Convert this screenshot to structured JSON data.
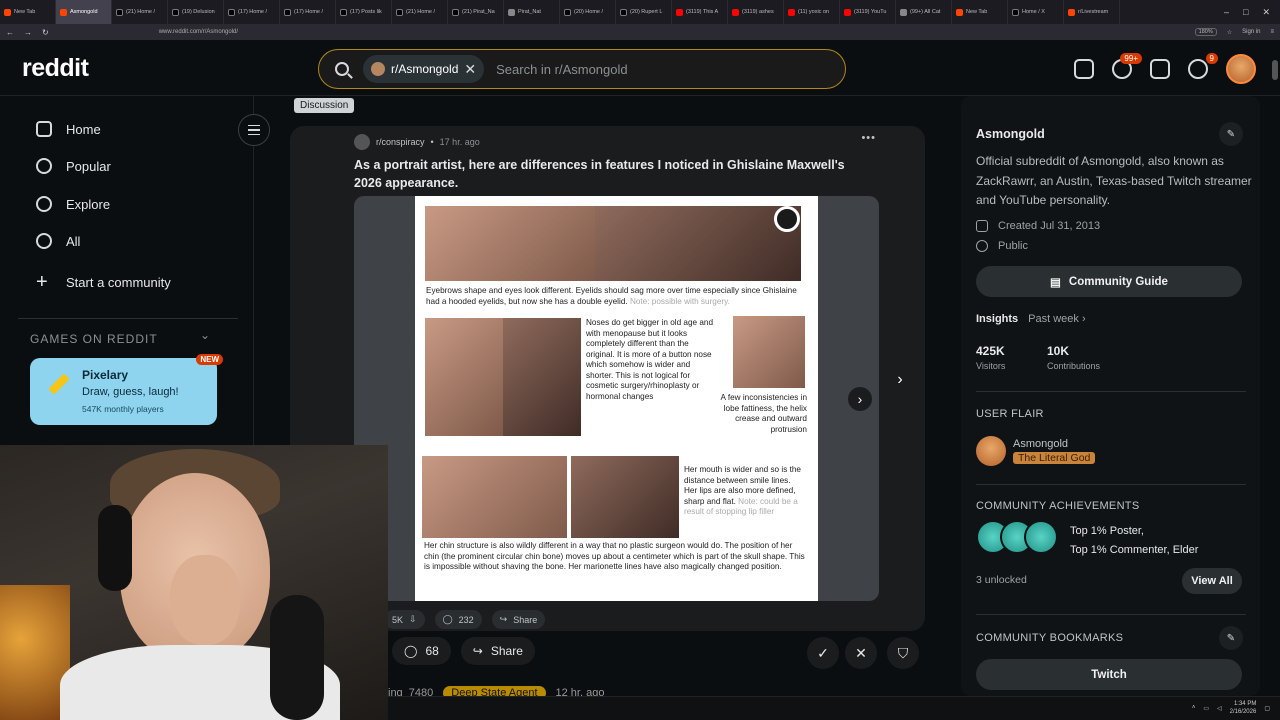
{
  "browser": {
    "tabs": [
      "New Tab",
      "Asmongold",
      "(21) Home /",
      "(19) Delusion",
      "(17) Home /",
      "(17) Home /",
      "(17) Posts lik",
      "(21) Home /",
      "(21) Pirat_Na",
      "Pirat_Nat",
      "(20) Home /",
      "(20) Rupert L",
      "(3119) This A",
      "(3119) ashes",
      "(11) yoxic on",
      "(3119) YouTu",
      "(99+) All Cat",
      "New Tab",
      "Home / X",
      "r/Livestream"
    ],
    "url": "www.reddit.com/r/Asmongold/",
    "zoom": "180%",
    "sign_in": "Sign in"
  },
  "header": {
    "logo": "reddit",
    "search_chip": "r/Asmongold",
    "search_placeholder": "Search in r/Asmongold",
    "chat_badge": "99+",
    "notif_badge": "9"
  },
  "leftnav": {
    "items": [
      "Home",
      "Popular",
      "Explore",
      "All",
      "Start a community"
    ],
    "games_heading": "GAMES ON REDDIT",
    "game": {
      "title": "Pixelary",
      "subtitle": "Draw, guess, laugh!",
      "players": "547K monthly players",
      "badge": "NEW"
    }
  },
  "feed": {
    "flair": "Discussion",
    "post": {
      "subreddit": "r/conspiracy",
      "age": "17 hr. ago",
      "title": "As a portrait artist, here are differences in features I noticed in Ghislaine Maxwell's 2026 appearance.",
      "doc": {
        "caption1": "Eyebrows shape and eyes look different. Eyelids should sag more over time especially since Ghislaine had a hooded eyelids, but now she has a double eyelid.",
        "caption1_note": "Note: possible with surgery.",
        "caption2": "Noses do get bigger in old age and with menopause but it looks completely different than the original. It is more of a button nose which somehow is wider and shorter. This is not logical for cosmetic surgery/rhinoplasty or hormonal changes",
        "caption3": "A few inconsistencies in lobe fattiness, the helix crease and outward protrusion",
        "caption4": "Her mouth is wider and so is the distance between smile lines. Her lips are also more defined, sharp and flat.",
        "caption4_note": "Note: could be a result of stopping lip filler",
        "caption5": "Her chin structure is also wildly different in a way that no plastic surgeon would do. The position of her chin (the prominent circular chin bone) moves up about a centimeter which is part of the skull shape. This is impossible without shaving the bone. Her marionette lines have also magically changed position."
      },
      "inner_votes": "5K",
      "inner_comments": "232",
      "inner_share": "Share"
    },
    "outer_comments": "68",
    "outer_share": "Share",
    "next_user": "ing_7480",
    "next_flair": "Deep State Agent",
    "next_age": "12 hr. ago"
  },
  "sidebar": {
    "title": "Asmongold",
    "description": "Official subreddit of Asmongold, also known as ZackRawrr, an Austin, Texas-based Twitch streamer and YouTube personality.",
    "created": "Created Jul 31, 2013",
    "visibility": "Public",
    "guide_button": "Community Guide",
    "insights_label": "Insights",
    "insights_period": "Past week",
    "visitors_value": "425K",
    "visitors_label": "Visitors",
    "contrib_value": "10K",
    "contrib_label": "Contributions",
    "user_flair_heading": "USER FLAIR",
    "flair_name": "Asmongold",
    "flair_tag": "The Literal God",
    "achievements_heading": "COMMUNITY ACHIEVEMENTS",
    "ach_line1": "Top 1% Poster,",
    "ach_line2": "Top 1% Commenter, Elder",
    "unlocked": "3 unlocked",
    "view_all": "View All",
    "bookmarks_heading": "COMMUNITY BOOKMARKS",
    "bookmark_button": "Twitch"
  },
  "taskbar": {
    "time": "1:34 PM",
    "date": "2/16/2026"
  }
}
